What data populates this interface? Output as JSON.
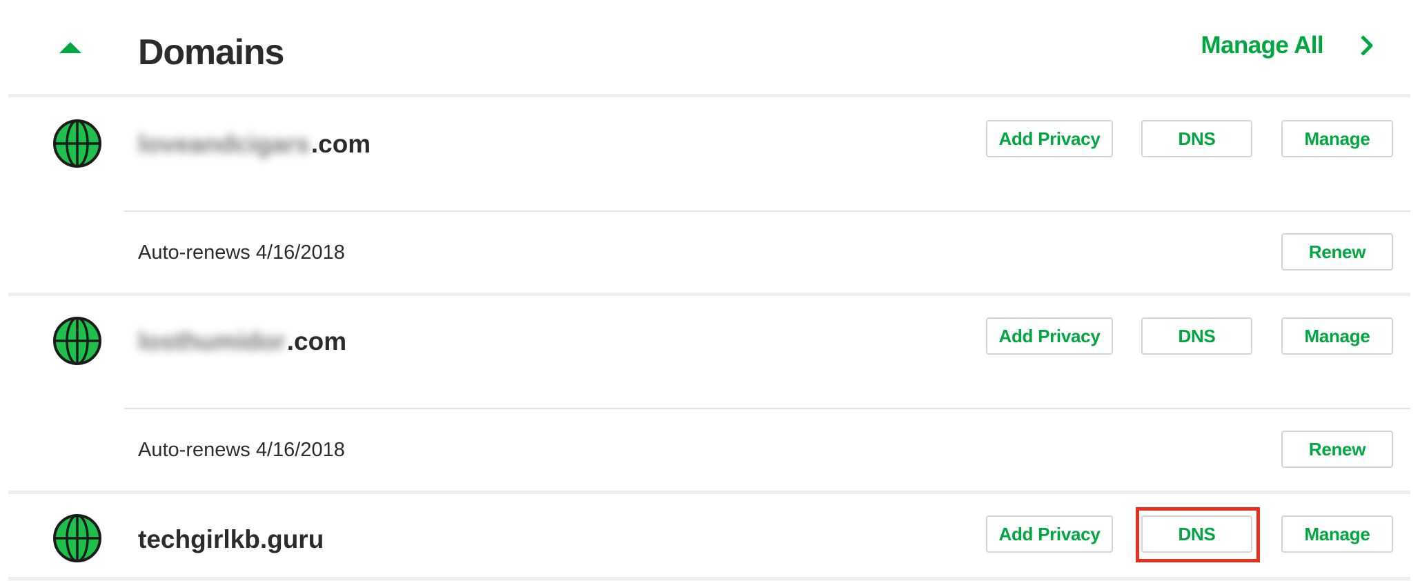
{
  "header": {
    "title": "Domains",
    "manage_all_label": "Manage All"
  },
  "domains": [
    {
      "name_hidden": "loveandcigars",
      "name_suffix": ".com",
      "add_privacy_label": "Add Privacy",
      "dns_label": "DNS",
      "manage_label": "Manage",
      "auto_renew": "Auto-renews 4/16/2018",
      "renew_label": "Renew"
    },
    {
      "name_hidden": "losthumidor",
      "name_suffix": ".com",
      "add_privacy_label": "Add Privacy",
      "dns_label": "DNS",
      "manage_label": "Manage",
      "auto_renew": "Auto-renews 4/16/2018",
      "renew_label": "Renew"
    },
    {
      "name": "techgirlkb.guru",
      "add_privacy_label": "Add Privacy",
      "dns_label": "DNS",
      "manage_label": "Manage"
    }
  ],
  "colors": {
    "brand_green": "#00a63f",
    "highlight_red": "#e8301c",
    "globe_fill": "#1fbf4c"
  },
  "icons": {
    "collapse": "caret-up-icon",
    "manage_all": "chevron-right-icon",
    "domain": "globe-icon"
  }
}
